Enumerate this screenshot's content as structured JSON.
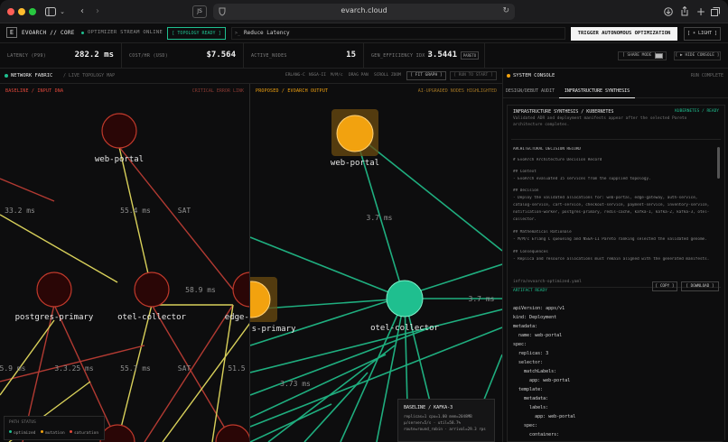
{
  "browser": {
    "url": "evarch.cloud",
    "extension_label": "JS",
    "icons": [
      "sidebar-icon",
      "back-icon",
      "forward-icon",
      "shield-icon",
      "reload-icon",
      "download-icon",
      "share-icon",
      "new-tab-icon",
      "tabs-icon"
    ]
  },
  "header": {
    "logo_letter": "E",
    "brand": "EVOARCH // CORE",
    "stream": "OPTIMIZER STREAM ONLINE",
    "topology_badge": "[ TOPOLOGY READY ]",
    "prompt_prefix": ">_",
    "prompt_value": "Reduce Latency",
    "trigger_label": "TRIGGER AUTONOMOUS OPTIMIZATION",
    "theme_label": "[ ☀ LIGHT ]"
  },
  "metrics": [
    {
      "label": "LATENCY (P99)",
      "value": "282.2 ms"
    },
    {
      "label": "COST/HR (USD)",
      "value": "$7.564"
    },
    {
      "label": "ACTIVE_NODES",
      "value": "15"
    },
    {
      "label": "GEN_EFFICIENCY IDX Σ",
      "value": "3.5441",
      "badge": "PARETO"
    }
  ],
  "controls": {
    "share_label": "[ SHARE MODE ]",
    "hide_console_label": "[ ▶ HIDE CONSOLE ]"
  },
  "fabric": {
    "title": "NETWORK FABRIC",
    "subtitle": "/ LIVE TOPOLOGY MAP",
    "toolbar": [
      "ERLANG-C",
      "NSGA-II",
      "M/M/c",
      "DRAG PAN",
      "SCROLL ZOOM"
    ],
    "fit_label": "[ FIT GRAPH ]",
    "run_label": "[ RUN TO START ]",
    "baseline": {
      "title": "BASELINE / INPUT DNA",
      "status": "CRITICAL ERROR LINK",
      "nodes": [
        {
          "name": "web-portal"
        },
        {
          "name": "postgres-primary"
        },
        {
          "name": "otel-collector"
        },
        {
          "name": "edge-g"
        }
      ],
      "edge_labels": [
        "33.2 ms",
        "55.4 ms",
        "SAT",
        "58.9 ms",
        "5.9 ms",
        "3.3.25 ms",
        "55.7 ms",
        "SAT",
        "51.5"
      ]
    },
    "proposed": {
      "title": "PROPOSED / EVOARCH OUTPUT",
      "status": "AI-UPGRADED NODES HIGHLIGHTED",
      "nodes": [
        {
          "name": "web-portal"
        },
        {
          "name": "s-primary"
        },
        {
          "name": "otel-collector"
        }
      ],
      "edge_labels": [
        "3.7 ms",
        "3.7 ms",
        "3.73 ms"
      ]
    },
    "legend": {
      "title": "PATH STATUS",
      "items": [
        {
          "label": "optimized",
          "color": "#1fbf8f"
        },
        {
          "label": "mutation",
          "color": "#f2a20f"
        },
        {
          "label": "saturation",
          "color": "#e5483b"
        }
      ]
    },
    "tooltip": {
      "title": "BASELINE / KAFKA-3",
      "lines": [
        "replicas=1 cpu=1.00 mem=2048MB",
        "μ/server=5/s · util=58.7%",
        "route=round_robin · arrival=29.3 rps"
      ]
    }
  },
  "console": {
    "title": "SYSTEM CONSOLE",
    "status": "RUN COMPLETE",
    "tabs": [
      "DESIGN/DEBUT AUDIT",
      "INFRASTRUCTURE SYNTHESIS"
    ],
    "active_tab": 1,
    "section_title": "INFRASTRUCTURE SYNTHESIS / KUBERNETES",
    "section_badge": "KUBERNETES / READY",
    "section_desc": "Validated ADR and deployment manifests appear after the selected Pareto architecture completes.",
    "doc": [
      {
        "text": "ARCHITECTURAL DECISION RECORD",
        "h": true
      },
      {
        "text": "# EvoArch Architecture Decision Record",
        "h": false
      },
      {
        "text": "## Context",
        "h": false
      },
      {
        "text": "- EvoArch evaluated 15 services from the supplied topology.",
        "h": false
      },
      {
        "text": "## Decision",
        "h": false
      },
      {
        "text": "- Deploy the validated allocations for: web-portal, edge-gateway, auth-service,",
        "h": false
      },
      {
        "text": "catalog-service, cart-service, checkout-service, payment-service, inventory-service,",
        "h": false
      },
      {
        "text": "notification-worker, postgres-primary, redis-cache, kafka-1, kafka-2, kafka-3, otel-",
        "h": false
      },
      {
        "text": "collector.",
        "h": false
      },
      {
        "text": "## Mathematical Rationale",
        "h": false
      },
      {
        "text": "- M/M/c Erlang C queueing and NSGA-II Pareto ranking selected the validated genome.",
        "h": false
      },
      {
        "text": "## Consequences",
        "h": false
      },
      {
        "text": "- Replica and resource allocations must remain aligned with the generated manifests.",
        "h": false
      }
    ],
    "yaml_file": "infra/evoarch-optimized.yaml",
    "artifact": "ARTIFACT READY",
    "copy_label": "[ COPY ]",
    "download_label": "[ DOWNLOAD ]",
    "yaml": [
      "apiVersion: apps/v1",
      "kind: Deployment",
      "metadata:",
      "  name: web-portal",
      "spec:",
      "  replicas: 3",
      "  selector:",
      "    matchLabels:",
      "      app: web-portal",
      "  template:",
      "    metadata:",
      "      labels:",
      "        app: web-portal",
      "    spec:",
      "      containers:"
    ]
  }
}
